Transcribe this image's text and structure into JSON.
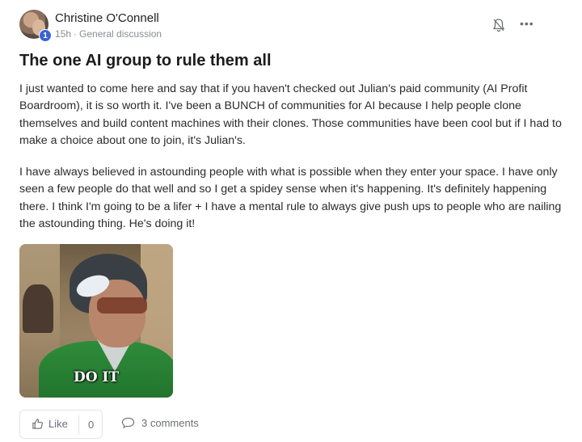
{
  "post": {
    "author": "Christine O'Connell",
    "author_level": "1",
    "time": "15h",
    "separator": "·",
    "category": "General discussion",
    "title": "The one AI group to rule them all",
    "paragraph_1": "I just wanted to come here and say that if you haven't checked out Julian's paid community (AI Profit Boardroom), it is so worth it. I've been a BUNCH of communities for AI because I help people clone themselves and build content machines with their clones. Those communities have been cool but if I had to make a choice about one to join, it's Julian's.",
    "paragraph_2": "I have always believed in astounding people with what is possible when they enter your space. I have only seen a few people do that well and so I get a spidey sense when it's happening. It's definitely happening there. I think I'm going to be a lifer + I have a mental rule to always give push ups to people who are nailing the astounding thing. He's doing it!",
    "image_caption": "DO IT",
    "more_label": "•••"
  },
  "footer": {
    "like_label": "Like",
    "like_count": "0",
    "comments_label": "3 comments"
  },
  "icons": {
    "bell": "bell-off-icon",
    "more": "more-horizontal-icon",
    "like": "thumbs-up-icon",
    "comment": "comment-bubble-icon"
  },
  "colors": {
    "level_badge": "#3a64d8",
    "muted_text": "#8a8d91"
  }
}
